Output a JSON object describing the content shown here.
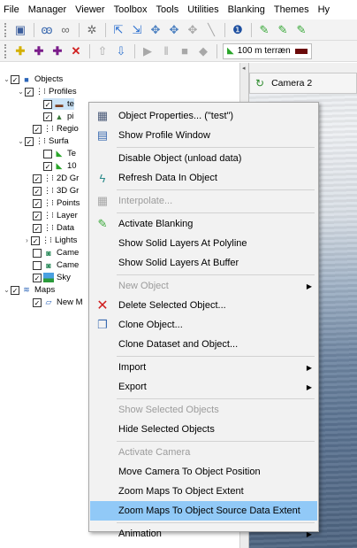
{
  "menubar": {
    "items": [
      "File",
      "Manager",
      "Viewer",
      "Toolbox",
      "Tools",
      "Utilities",
      "Blanking",
      "Themes",
      "Hy"
    ]
  },
  "toolbar": {
    "terrain_label": "100 m terræn"
  },
  "tree": {
    "items": [
      {
        "label": "Objects",
        "icon": "objects-icon"
      },
      {
        "label": "Profiles",
        "icon": "folder-icon"
      },
      {
        "label": "te",
        "icon": "profile-icon"
      },
      {
        "label": "pi",
        "icon": "profile-picture-icon"
      },
      {
        "label": "Regio",
        "icon": "folder-icon"
      },
      {
        "label": "Surfa",
        "icon": "folder-icon"
      },
      {
        "label": "Te",
        "icon": "terrain-icon"
      },
      {
        "label": "10",
        "icon": "terrain-icon"
      },
      {
        "label": "2D Gr",
        "icon": "folder-icon"
      },
      {
        "label": "3D Gr",
        "icon": "folder-icon"
      },
      {
        "label": "Points",
        "icon": "folder-icon"
      },
      {
        "label": "Layer",
        "icon": "folder-icon"
      },
      {
        "label": "Data",
        "icon": "folder-icon"
      },
      {
        "label": "Lights",
        "icon": "folder-icon"
      },
      {
        "label": "Came",
        "icon": "camera-icon"
      },
      {
        "label": "Came",
        "icon": "camera-icon"
      },
      {
        "label": "Sky",
        "icon": "sky-icon"
      },
      {
        "label": "Maps",
        "icon": "maps-icon"
      },
      {
        "label": "New M",
        "icon": "map-icon"
      }
    ]
  },
  "viewer": {
    "camera_label": "Camera 2"
  },
  "context_menu": {
    "items": [
      {
        "label": "Object Properties... (\"test\")",
        "icon": "properties-icon"
      },
      {
        "label": "Show Profile Window",
        "icon": "profile-window-icon"
      },
      {
        "label": "Disable Object (unload data)",
        "icon": ""
      },
      {
        "label": "Refresh Data In Object",
        "icon": "refresh-icon"
      },
      {
        "label": "Interpolate...",
        "icon": "interpolate-icon"
      },
      {
        "label": "Activate Blanking",
        "icon": "blanking-icon"
      },
      {
        "label": "Show Solid Layers At Polyline",
        "icon": ""
      },
      {
        "label": "Show Solid Layers At Buffer",
        "icon": ""
      },
      {
        "label": "New Object",
        "icon": ""
      },
      {
        "label": "Delete Selected Object...",
        "icon": "delete-icon"
      },
      {
        "label": "Clone Object...",
        "icon": "clone-icon"
      },
      {
        "label": "Clone Dataset and Object...",
        "icon": ""
      },
      {
        "label": "Import",
        "icon": ""
      },
      {
        "label": "Export",
        "icon": ""
      },
      {
        "label": "Show Selected Objects",
        "icon": ""
      },
      {
        "label": "Hide Selected Objects",
        "icon": ""
      },
      {
        "label": "Activate Camera",
        "icon": ""
      },
      {
        "label": "Move Camera To Object Position",
        "icon": ""
      },
      {
        "label": "Zoom Maps To Object Extent",
        "icon": ""
      },
      {
        "label": "Zoom Maps To Object Source Data Extent",
        "icon": ""
      },
      {
        "label": "Animation",
        "icon": ""
      }
    ]
  }
}
